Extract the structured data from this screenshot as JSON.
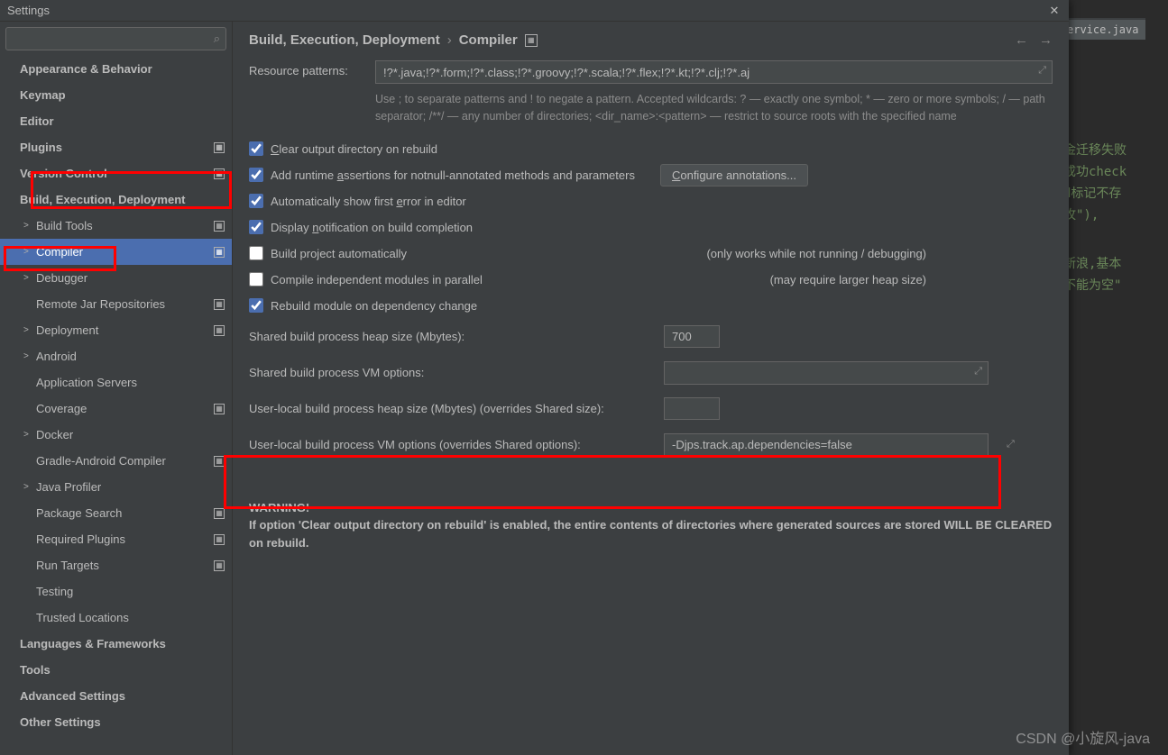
{
  "title": "Settings",
  "editor_tab": "ervice.java",
  "editor_lines": [
    "金迁移失败",
    "成功check",
    "d标记不存",
    "攻\"),",
    "新浪,基本",
    "不能为空\""
  ],
  "search_placeholder": "",
  "sidebar": {
    "items": [
      {
        "label": "Appearance & Behavior",
        "top": true
      },
      {
        "label": "Keymap",
        "top": true
      },
      {
        "label": "Editor",
        "top": true
      },
      {
        "label": "Plugins",
        "top": true,
        "badge": true
      },
      {
        "label": "Version Control",
        "top": true,
        "badge": true
      },
      {
        "label": "Build, Execution, Deployment",
        "top": true
      },
      {
        "label": "Build Tools",
        "child": true,
        "arrow": ">",
        "badge": true
      },
      {
        "label": "Compiler",
        "child": true,
        "arrow": ">",
        "badge": true,
        "selected": true
      },
      {
        "label": "Debugger",
        "child": true,
        "arrow": ">"
      },
      {
        "label": "Remote Jar Repositories",
        "child": true,
        "badge": true
      },
      {
        "label": "Deployment",
        "child": true,
        "arrow": ">",
        "badge": true
      },
      {
        "label": "Android",
        "child": true,
        "arrow": ">"
      },
      {
        "label": "Application Servers",
        "child": true
      },
      {
        "label": "Coverage",
        "child": true,
        "badge": true
      },
      {
        "label": "Docker",
        "child": true,
        "arrow": ">"
      },
      {
        "label": "Gradle-Android Compiler",
        "child": true,
        "badge": true
      },
      {
        "label": "Java Profiler",
        "child": true,
        "arrow": ">"
      },
      {
        "label": "Package Search",
        "child": true,
        "badge": true
      },
      {
        "label": "Required Plugins",
        "child": true,
        "badge": true
      },
      {
        "label": "Run Targets",
        "child": true,
        "badge": true
      },
      {
        "label": "Testing",
        "child": true
      },
      {
        "label": "Trusted Locations",
        "child": true
      },
      {
        "label": "Languages & Frameworks",
        "top": true
      },
      {
        "label": "Tools",
        "top": true
      },
      {
        "label": "Advanced Settings",
        "top": true
      },
      {
        "label": "Other Settings",
        "top": true
      }
    ]
  },
  "breadcrumb": {
    "a": "Build, Execution, Deployment",
    "b": "Compiler"
  },
  "resource_patterns_label": "Resource patterns:",
  "resource_patterns_value": "!?*.java;!?*.form;!?*.class;!?*.groovy;!?*.scala;!?*.flex;!?*.kt;!?*.clj;!?*.aj",
  "resource_hint": "Use ; to separate patterns and ! to negate a pattern. Accepted wildcards: ? — exactly one symbol; * — zero or more symbols; / — path separator; /**/ — any number of directories; <dir_name>:<pattern> — restrict to source roots with the specified name",
  "checks": {
    "clear": "Clear output directory on rebuild",
    "runtime": "Add runtime assertions for notnull-annotated methods and parameters",
    "configure": "Configure annotations...",
    "auto_error": "Automatically show first error in editor",
    "notify": "Display notification on build completion",
    "build_auto": "Build project automatically",
    "build_auto_aside": "(only works while not running / debugging)",
    "parallel": "Compile independent modules in parallel",
    "parallel_aside": "(may require larger heap size)",
    "rebuild_dep": "Rebuild module on dependency change"
  },
  "fields": {
    "shared_heap_label": "Shared build process heap size (Mbytes):",
    "shared_heap_value": "700",
    "shared_vm_label": "Shared build process VM options:",
    "shared_vm_value": "",
    "local_heap_label": "User-local build process heap size (Mbytes) (overrides Shared size):",
    "local_heap_value": "",
    "local_vm_label": "User-local build process VM options (overrides Shared options):",
    "local_vm_value": "-Djps.track.ap.dependencies=false"
  },
  "warning_title": "WARNING!",
  "warning_body": "If option 'Clear output directory on rebuild' is enabled, the entire contents of directories where generated sources are stored WILL BE CLEARED on rebuild.",
  "watermark": "CSDN @小旋风-java"
}
